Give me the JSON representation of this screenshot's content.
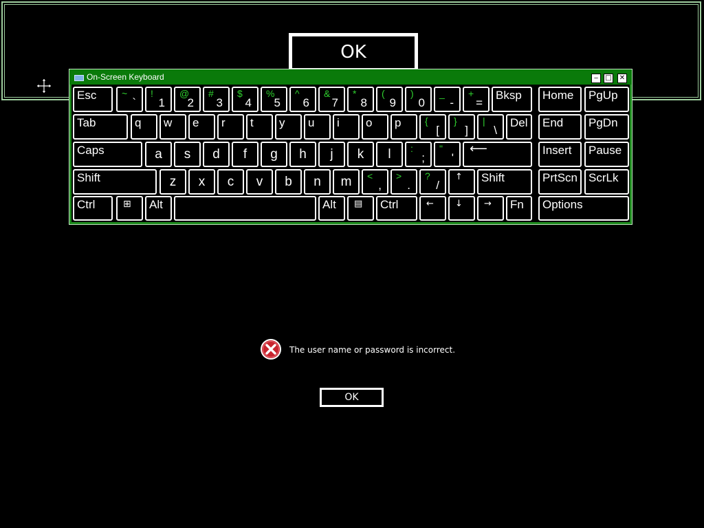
{
  "background_dialog": {
    "ok_label": "OK"
  },
  "osk": {
    "title": "On-Screen Keyboard",
    "window_buttons": {
      "minimize": "‒",
      "maximize": "□",
      "close": "✕"
    },
    "accent_color": "#0a7a0a",
    "shift_color": "#2fd12f",
    "keys": {
      "esc": "Esc",
      "grave": {
        "shift": "~",
        "char": "`"
      },
      "d1": {
        "shift": "!",
        "char": "1"
      },
      "d2": {
        "shift": "@",
        "char": "2"
      },
      "d3": {
        "shift": "#",
        "char": "3"
      },
      "d4": {
        "shift": "$",
        "char": "4"
      },
      "d5": {
        "shift": "%",
        "char": "5"
      },
      "d6": {
        "shift": "^",
        "char": "6"
      },
      "d7": {
        "shift": "&",
        "char": "7"
      },
      "d8": {
        "shift": "*",
        "char": "8"
      },
      "d9": {
        "shift": "(",
        "char": "9"
      },
      "d0": {
        "shift": ")",
        "char": "0"
      },
      "minus": {
        "shift": "_",
        "char": "-"
      },
      "equals": {
        "shift": "+",
        "char": "="
      },
      "bksp": "Bksp",
      "home": "Home",
      "pgup": "PgUp",
      "tab": "Tab",
      "q": "q",
      "w": "w",
      "e": "e",
      "r": "r",
      "t": "t",
      "y": "y",
      "u": "u",
      "i": "i",
      "o": "o",
      "p": "p",
      "lbracket": {
        "shift": "{",
        "char": "["
      },
      "rbracket": {
        "shift": "}",
        "char": "]"
      },
      "backslash": {
        "shift": "|",
        "char": "\\"
      },
      "del": "Del",
      "end": "End",
      "pgdn": "PgDn",
      "caps": "Caps",
      "a": "a",
      "s": "s",
      "d": "d",
      "f": "f",
      "g": "g",
      "h": "h",
      "j": "j",
      "k": "k",
      "l": "l",
      "semicolon": {
        "shift": ":",
        "char": ";"
      },
      "quote": {
        "shift": "\"",
        "char": "'"
      },
      "enter": "⟵",
      "insert": "Insert",
      "pause": "Pause",
      "lshift": "Shift",
      "z": "z",
      "x": "x",
      "c": "c",
      "v": "v",
      "b": "b",
      "n": "n",
      "m": "m",
      "comma": {
        "shift": "<",
        "char": ","
      },
      "period": {
        "shift": ">",
        "char": "."
      },
      "slash": {
        "shift": "?",
        "char": "/"
      },
      "up": "↑",
      "rshift": "Shift",
      "prtscn": "PrtScn",
      "scrlk": "ScrLk",
      "lctrl": "Ctrl",
      "win": "⊞",
      "lalt": "Alt",
      "space": "",
      "ralt": "Alt",
      "menu": "▤",
      "rctrl": "Ctrl",
      "left": "←",
      "down": "↓",
      "right": "→",
      "fn": "Fn",
      "options": "Options"
    }
  },
  "error_dialog": {
    "icon": "error-x-icon",
    "message": "The user name or password is incorrect.",
    "ok_label": "OK"
  }
}
